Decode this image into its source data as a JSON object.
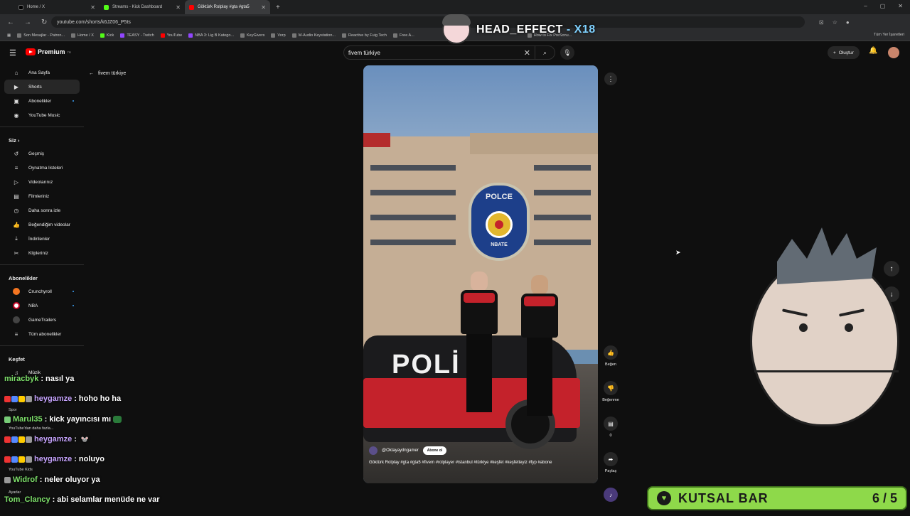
{
  "browser": {
    "tabs": [
      {
        "label": "Home / X",
        "color": "#000000"
      },
      {
        "label": "Streams - Kick Dashboard",
        "color": "#53fc18"
      },
      {
        "label": "Göktürk Rolplay #gta #gta5",
        "color": "#ff0000"
      }
    ],
    "url": "youtube.com/shorts/k6JZ06_P5ts",
    "bookmarks": [
      "Son Mesajlar - Patron...",
      "Home / X",
      "Kick",
      "TEASY - Twitch",
      "YouTube",
      "NBA 3: Lig B Katego...",
      "KeyGivers",
      "Vorp",
      "M-Audio Keystation...",
      "Reactive by Fuig Tech",
      "Free A...",
      "How to Fix PreSonu..."
    ],
    "bookmarks_right": "Tüm Yer İşaretleri"
  },
  "overlay": {
    "name": "HEAD_EFFECT",
    "suffix": "- X18"
  },
  "youtube": {
    "brand": "Premium",
    "brand_region": "TR",
    "search_value": "fivem türkiye",
    "create_label": "Oluştur",
    "back_label": "fivem türkiye"
  },
  "sidebar": {
    "main": [
      {
        "label": "Ana Sayfa",
        "icon": "home-icon",
        "glyph": "⌂"
      },
      {
        "label": "Shorts",
        "icon": "shorts-icon",
        "glyph": "▶"
      },
      {
        "label": "Abonelikler",
        "icon": "subscriptions-icon",
        "glyph": "▣"
      },
      {
        "label": "YouTube Music",
        "icon": "music-icon",
        "glyph": "◉"
      }
    ],
    "you_header": "Siz",
    "you": [
      {
        "label": "Geçmiş",
        "glyph": "↺"
      },
      {
        "label": "Oynatma listeleri",
        "glyph": "≡"
      },
      {
        "label": "Videolarınız",
        "glyph": "▷"
      },
      {
        "label": "Filmleriniz",
        "glyph": "▤"
      },
      {
        "label": "Daha sonra izle",
        "glyph": "◷"
      },
      {
        "label": "Beğendiğim videolar",
        "glyph": "👍"
      },
      {
        "label": "İndirilenler",
        "glyph": "⤓"
      },
      {
        "label": "Klipleriniz",
        "glyph": "✂"
      }
    ],
    "subs_header": "Abonelikler",
    "subs": [
      {
        "label": "Crunchyroll",
        "color": "#f47521"
      },
      {
        "label": "NBA",
        "color": "#c9082a"
      },
      {
        "label": "GameTrailers",
        "color": "#444444"
      },
      {
        "label": "Tüm abonelikler",
        "color": "#000000"
      }
    ],
    "explore_header": "Keşfet",
    "explore": [
      {
        "label": "Müzik"
      }
    ]
  },
  "short": {
    "channel": "@Oktayaydngamer",
    "subscribe": "Abone ol",
    "description": "Göktürk Rolplay #gta #gta5 #fivem #rolplayer #istanbul #türkiye #keşfet #keşfetteyiz #fyp #abone",
    "badge_top": "POLCE",
    "badge_bottom": "NBATE",
    "car_text": "POLİ",
    "actions": [
      {
        "label": "Beğen",
        "glyph": "👍"
      },
      {
        "label": "Beğenme",
        "glyph": "👎"
      },
      {
        "label": "0",
        "glyph": "▤"
      },
      {
        "label": "Paylaş",
        "glyph": "➦"
      }
    ]
  },
  "chat": [
    {
      "user": "miracbyk",
      "text": "nasıl ya",
      "color": "#7de06a"
    },
    {
      "user": "heygamze",
      "text": "hoho ho ha",
      "color": "#c7a4ff"
    },
    {
      "user": "Marul35",
      "text": "kick yayıncısı mı",
      "color": "#7de06a"
    },
    {
      "user": "heygamze",
      "text": "",
      "color": "#c7a4ff"
    },
    {
      "user": "heygamze",
      "text": "noluyo",
      "color": "#c7a4ff"
    },
    {
      "user": "Widrof",
      "text": "neler oluyor ya",
      "color": "#7de06a"
    },
    {
      "user": "Tom_Clancy",
      "text": "abi selamlar menüde ne var",
      "color": "#7de06a"
    }
  ],
  "chat_under": [
    "Spor",
    "YouTube'dan daha fazla...",
    "YouTube Kids",
    "Ayarlar"
  ],
  "goal_bar": {
    "label": "KUTSAL BAR",
    "count": "6 / 5",
    "color": "#8ed94a"
  }
}
